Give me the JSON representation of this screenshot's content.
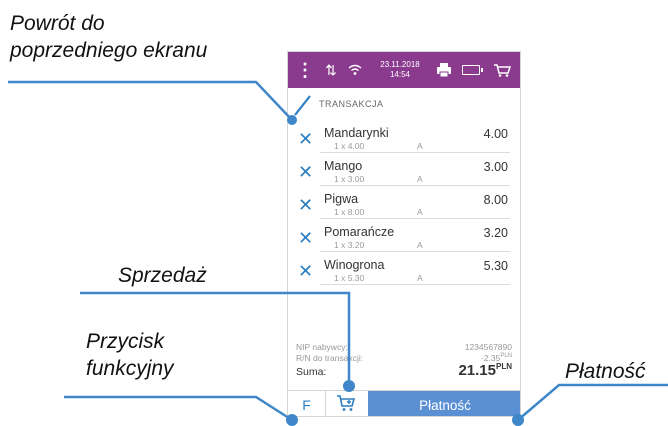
{
  "callouts": {
    "back_line1": "Powrót do",
    "back_line2": "poprzedniego ekranu",
    "sale": "Sprzedaż",
    "func_line1": "Przycisk",
    "func_line2": "funkcyjny",
    "pay": "Płatność"
  },
  "status_bar": {
    "date": "23.11.2018",
    "time": "14:54"
  },
  "transaction": {
    "title": "TRANSAKCJA",
    "items": [
      {
        "name": "Mandarynki",
        "qty": "1 x 4.00",
        "vat": "A",
        "price": "4.00"
      },
      {
        "name": "Mango",
        "qty": "1 x 3.00",
        "vat": "A",
        "price": "3.00"
      },
      {
        "name": "Pigwa",
        "qty": "1 x 8.00",
        "vat": "A",
        "price": "8.00"
      },
      {
        "name": "Pomarańcze",
        "qty": "1 x 3.20",
        "vat": "A",
        "price": "3.20"
      },
      {
        "name": "Winogrona",
        "qty": "1 x 5.30",
        "vat": "A",
        "price": "5.30"
      }
    ]
  },
  "summary": {
    "nip_label": "NIP nabywcy:",
    "nip_value": "1234567890",
    "discount_label": "R/N do transakcji:",
    "discount_value": "-2.35",
    "discount_currency": "PLN",
    "total_label": "Suma:",
    "total_value": "21.15",
    "total_currency": "PLN"
  },
  "bottom_bar": {
    "function_label": "F",
    "pay_label": "Płatność"
  },
  "colors": {
    "status_bar": "#8a3b8e",
    "accent": "#2b7ec1",
    "pay_button": "#5b8fd3",
    "callout_line": "#3f87c8"
  },
  "icons": [
    "menu-icon",
    "signal-icon",
    "wifi-icon",
    "printer-icon",
    "battery-icon",
    "cart-icon",
    "back-icon",
    "remove-icon",
    "sale-cart-icon"
  ]
}
